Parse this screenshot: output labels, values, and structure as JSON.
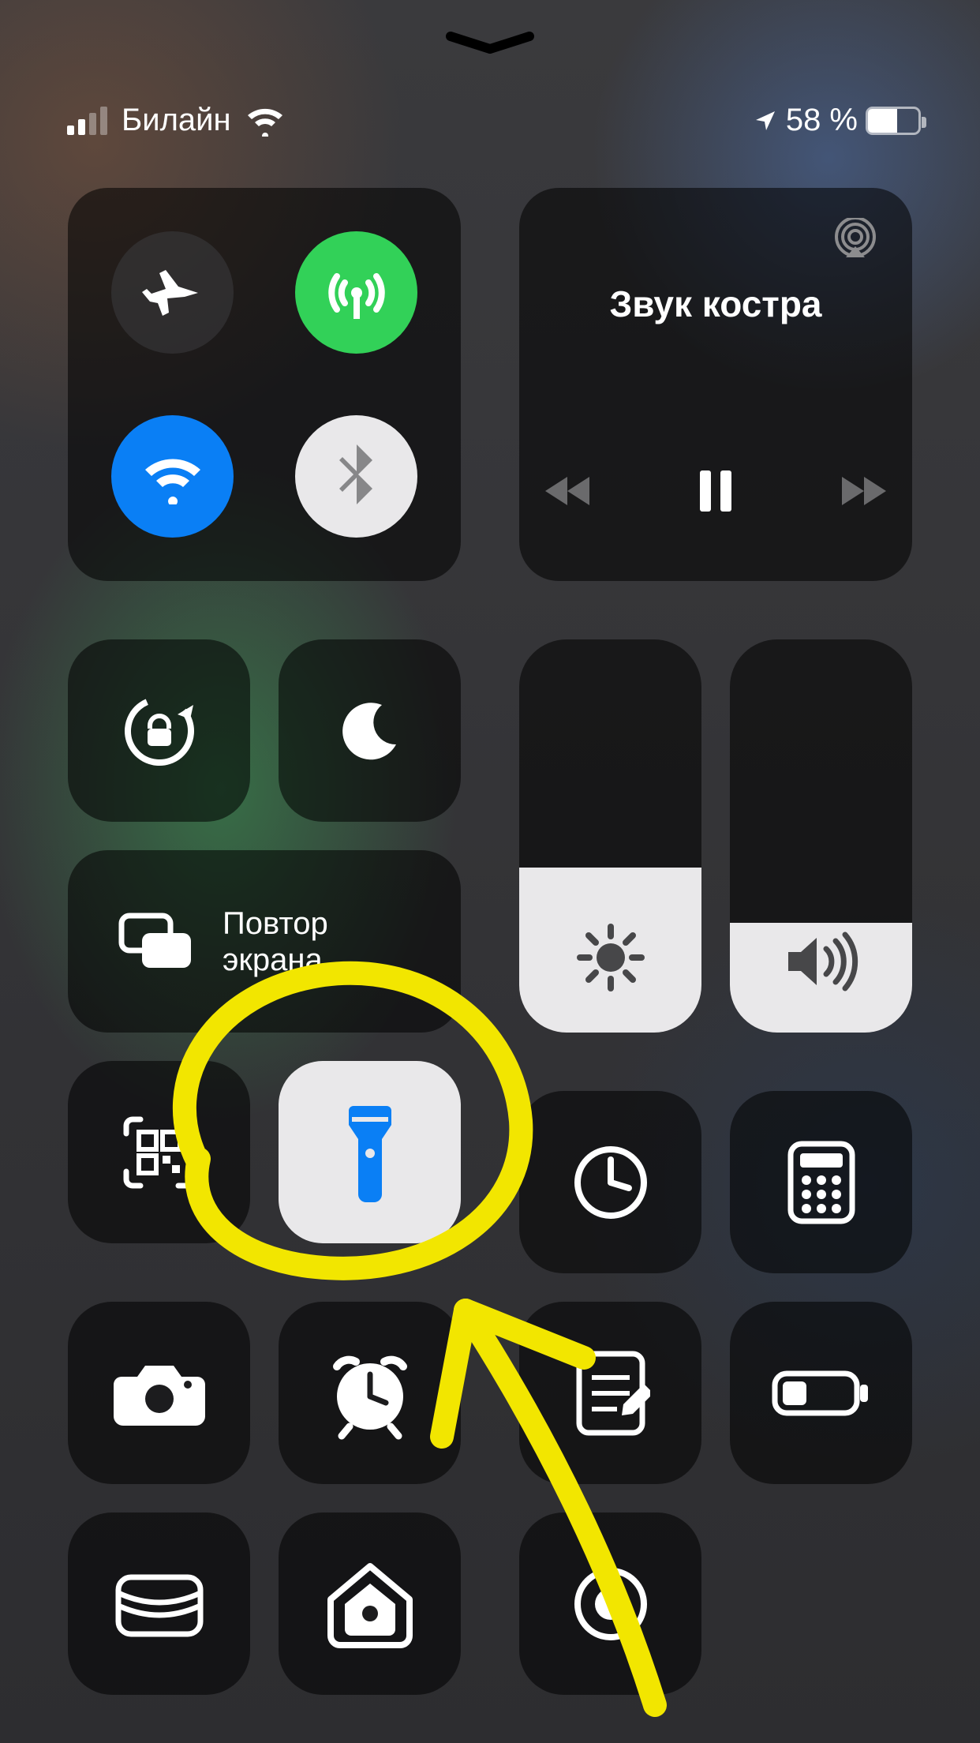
{
  "status_bar": {
    "carrier": "Билайн",
    "battery_text": "58 %",
    "battery_percent": 58
  },
  "media": {
    "title": "Звук костра"
  },
  "screen_mirroring": {
    "label_line1": "Повтор",
    "label_line2": "экрана"
  },
  "brightness": {
    "level_percent": 42
  },
  "volume": {
    "level_percent": 28
  },
  "colors": {
    "accent_green": "#32d158",
    "accent_blue": "#0a7ff5",
    "flash_blue": "#0a7ff5",
    "annotation_yellow": "#f2e600"
  }
}
